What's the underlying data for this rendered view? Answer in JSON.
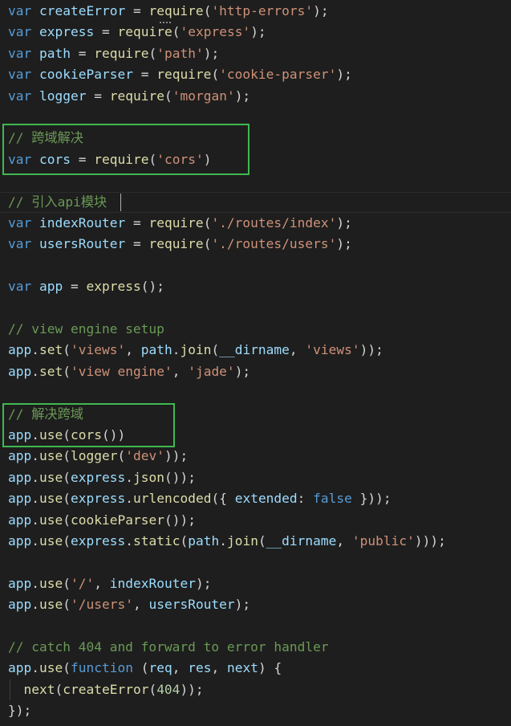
{
  "editor": {
    "background": "#1e1e1e",
    "colors": {
      "keyword": "#569cd6",
      "variable": "#9cdcfe",
      "function": "#dcdcaa",
      "string": "#ce9178",
      "comment": "#6a9955",
      "punctuation": "#d4d4d4",
      "highlight_box": "#3fb950"
    },
    "lines": [
      [
        [
          "kw",
          "var"
        ],
        [
          "p",
          " "
        ],
        [
          "var",
          "createError"
        ],
        [
          "p",
          " = "
        ],
        [
          "fn",
          "require"
        ],
        [
          "p",
          "("
        ],
        [
          "str",
          "'http-errors'"
        ],
        [
          "p",
          ");"
        ]
      ],
      [
        [
          "kw",
          "var"
        ],
        [
          "p",
          " "
        ],
        [
          "var",
          "express"
        ],
        [
          "p",
          " = "
        ],
        [
          "fn",
          "require"
        ],
        [
          "p",
          "("
        ],
        [
          "str",
          "'express'"
        ],
        [
          "p",
          ");"
        ]
      ],
      [
        [
          "kw",
          "var"
        ],
        [
          "p",
          " "
        ],
        [
          "var",
          "path"
        ],
        [
          "p",
          " = "
        ],
        [
          "fn",
          "require"
        ],
        [
          "p",
          "("
        ],
        [
          "str",
          "'path'"
        ],
        [
          "p",
          ");"
        ]
      ],
      [
        [
          "kw",
          "var"
        ],
        [
          "p",
          " "
        ],
        [
          "var",
          "cookieParser"
        ],
        [
          "p",
          " = "
        ],
        [
          "fn",
          "require"
        ],
        [
          "p",
          "("
        ],
        [
          "str",
          "'cookie-parser'"
        ],
        [
          "p",
          ");"
        ]
      ],
      [
        [
          "kw",
          "var"
        ],
        [
          "p",
          " "
        ],
        [
          "var",
          "logger"
        ],
        [
          "p",
          " = "
        ],
        [
          "fn",
          "require"
        ],
        [
          "p",
          "("
        ],
        [
          "str",
          "'morgan'"
        ],
        [
          "p",
          ");"
        ]
      ],
      [],
      [
        [
          "cm",
          "// 跨域解决"
        ]
      ],
      [
        [
          "kw",
          "var"
        ],
        [
          "p",
          " "
        ],
        [
          "var",
          "cors"
        ],
        [
          "p",
          " = "
        ],
        [
          "fn",
          "require"
        ],
        [
          "p",
          "("
        ],
        [
          "str",
          "'cors'"
        ],
        [
          "p",
          ")"
        ]
      ],
      [],
      [
        [
          "cm",
          "// 引入api模块"
        ]
      ],
      [
        [
          "kw",
          "var"
        ],
        [
          "p",
          " "
        ],
        [
          "var",
          "indexRouter"
        ],
        [
          "p",
          " = "
        ],
        [
          "fn",
          "require"
        ],
        [
          "p",
          "("
        ],
        [
          "str",
          "'./routes/index'"
        ],
        [
          "p",
          ");"
        ]
      ],
      [
        [
          "kw",
          "var"
        ],
        [
          "p",
          " "
        ],
        [
          "var",
          "usersRouter"
        ],
        [
          "p",
          " = "
        ],
        [
          "fn",
          "require"
        ],
        [
          "p",
          "("
        ],
        [
          "str",
          "'./routes/users'"
        ],
        [
          "p",
          ");"
        ]
      ],
      [],
      [
        [
          "kw",
          "var"
        ],
        [
          "p",
          " "
        ],
        [
          "var",
          "app"
        ],
        [
          "p",
          " = "
        ],
        [
          "fn",
          "express"
        ],
        [
          "p",
          "();"
        ]
      ],
      [],
      [
        [
          "cm",
          "// view engine setup"
        ]
      ],
      [
        [
          "var",
          "app"
        ],
        [
          "p",
          "."
        ],
        [
          "fn",
          "set"
        ],
        [
          "p",
          "("
        ],
        [
          "str",
          "'views'"
        ],
        [
          "p",
          ", "
        ],
        [
          "var",
          "path"
        ],
        [
          "p",
          "."
        ],
        [
          "fn",
          "join"
        ],
        [
          "p",
          "("
        ],
        [
          "var",
          "__dirname"
        ],
        [
          "p",
          ", "
        ],
        [
          "str",
          "'views'"
        ],
        [
          "p",
          "));"
        ]
      ],
      [
        [
          "var",
          "app"
        ],
        [
          "p",
          "."
        ],
        [
          "fn",
          "set"
        ],
        [
          "p",
          "("
        ],
        [
          "str",
          "'view engine'"
        ],
        [
          "p",
          ", "
        ],
        [
          "str",
          "'jade'"
        ],
        [
          "p",
          ");"
        ]
      ],
      [],
      [
        [
          "cm",
          "// 解决跨域"
        ]
      ],
      [
        [
          "var",
          "app"
        ],
        [
          "p",
          "."
        ],
        [
          "fn",
          "use"
        ],
        [
          "p",
          "("
        ],
        [
          "fn",
          "cors"
        ],
        [
          "p",
          "())"
        ]
      ],
      [
        [
          "var",
          "app"
        ],
        [
          "p",
          "."
        ],
        [
          "fn",
          "use"
        ],
        [
          "p",
          "("
        ],
        [
          "fn",
          "logger"
        ],
        [
          "p",
          "("
        ],
        [
          "str",
          "'dev'"
        ],
        [
          "p",
          "));"
        ]
      ],
      [
        [
          "var",
          "app"
        ],
        [
          "p",
          "."
        ],
        [
          "fn",
          "use"
        ],
        [
          "p",
          "("
        ],
        [
          "var",
          "express"
        ],
        [
          "p",
          "."
        ],
        [
          "fn",
          "json"
        ],
        [
          "p",
          "());"
        ]
      ],
      [
        [
          "var",
          "app"
        ],
        [
          "p",
          "."
        ],
        [
          "fn",
          "use"
        ],
        [
          "p",
          "("
        ],
        [
          "var",
          "express"
        ],
        [
          "p",
          "."
        ],
        [
          "fn",
          "urlencoded"
        ],
        [
          "p",
          "({ "
        ],
        [
          "var",
          "extended"
        ],
        [
          "p",
          ": "
        ],
        [
          "kw",
          "false"
        ],
        [
          "p",
          " }));"
        ]
      ],
      [
        [
          "var",
          "app"
        ],
        [
          "p",
          "."
        ],
        [
          "fn",
          "use"
        ],
        [
          "p",
          "("
        ],
        [
          "fn",
          "cookieParser"
        ],
        [
          "p",
          "());"
        ]
      ],
      [
        [
          "var",
          "app"
        ],
        [
          "p",
          "."
        ],
        [
          "fn",
          "use"
        ],
        [
          "p",
          "("
        ],
        [
          "var",
          "express"
        ],
        [
          "p",
          "."
        ],
        [
          "fn",
          "static"
        ],
        [
          "p",
          "("
        ],
        [
          "var",
          "path"
        ],
        [
          "p",
          "."
        ],
        [
          "fn",
          "join"
        ],
        [
          "p",
          "("
        ],
        [
          "var",
          "__dirname"
        ],
        [
          "p",
          ", "
        ],
        [
          "str",
          "'public'"
        ],
        [
          "p",
          ")));"
        ]
      ],
      [],
      [
        [
          "var",
          "app"
        ],
        [
          "p",
          "."
        ],
        [
          "fn",
          "use"
        ],
        [
          "p",
          "("
        ],
        [
          "str",
          "'/'"
        ],
        [
          "p",
          ", "
        ],
        [
          "var",
          "indexRouter"
        ],
        [
          "p",
          ");"
        ]
      ],
      [
        [
          "var",
          "app"
        ],
        [
          "p",
          "."
        ],
        [
          "fn",
          "use"
        ],
        [
          "p",
          "("
        ],
        [
          "str",
          "'/users'"
        ],
        [
          "p",
          ", "
        ],
        [
          "var",
          "usersRouter"
        ],
        [
          "p",
          ");"
        ]
      ],
      [],
      [
        [
          "cm",
          "// catch 404 and forward to error handler"
        ]
      ],
      [
        [
          "var",
          "app"
        ],
        [
          "p",
          "."
        ],
        [
          "fn",
          "use"
        ],
        [
          "p",
          "("
        ],
        [
          "kw",
          "function"
        ],
        [
          "p",
          " ("
        ],
        [
          "var",
          "req"
        ],
        [
          "p",
          ", "
        ],
        [
          "var",
          "res"
        ],
        [
          "p",
          ", "
        ],
        [
          "var",
          "next"
        ],
        [
          "p",
          ") {"
        ]
      ],
      [
        [
          "p",
          "  "
        ],
        [
          "fn",
          "next"
        ],
        [
          "p",
          "("
        ],
        [
          "fn",
          "createError"
        ],
        [
          "p",
          "("
        ],
        [
          "num",
          "404"
        ],
        [
          "p",
          "));"
        ]
      ],
      [
        [
          "p",
          "});"
        ]
      ]
    ]
  }
}
